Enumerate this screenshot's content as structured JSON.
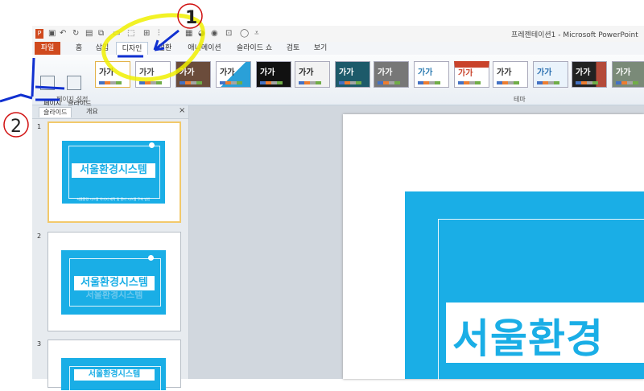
{
  "app": {
    "title": "프레젠테이션1 - Microsoft PowerPoint"
  },
  "tabs": [
    "파일",
    "홈",
    "삽입",
    "디자인",
    "전환",
    "애니메이션",
    "슬라이드 쇼",
    "검토",
    "보기"
  ],
  "ribbon": {
    "page_setup_label": "페이지\n설정",
    "orientation_label": "슬라이드\n방향 ▾",
    "group_label": "페이지 설정",
    "themes_label": "테마",
    "theme_sample_text": "가가"
  },
  "panel": {
    "tab_slides": "슬라이드",
    "tab_outline": "개요",
    "close": "×"
  },
  "slides": [
    {
      "number": "1",
      "title": "서울환경시스템",
      "subtitle": "서울환경 시스템 이미지 제작 및 관리 시스템 구축 방안"
    },
    {
      "number": "2",
      "title": "서울환경시스템",
      "subtitle": "서울환경시스템"
    },
    {
      "number": "3",
      "title": "서울환경시스템",
      "subtitle": ""
    }
  ],
  "main_slide": {
    "title": "서울환경"
  },
  "annotations": {
    "mark_1": "1",
    "mark_2": "2"
  },
  "colors": {
    "slide_blue": "#1aaee6",
    "file_tab": "#d04a1e",
    "highlight_yellow": "#f0f000",
    "annotation_blue": "#1030d0",
    "annotation_red": "#d01010"
  }
}
